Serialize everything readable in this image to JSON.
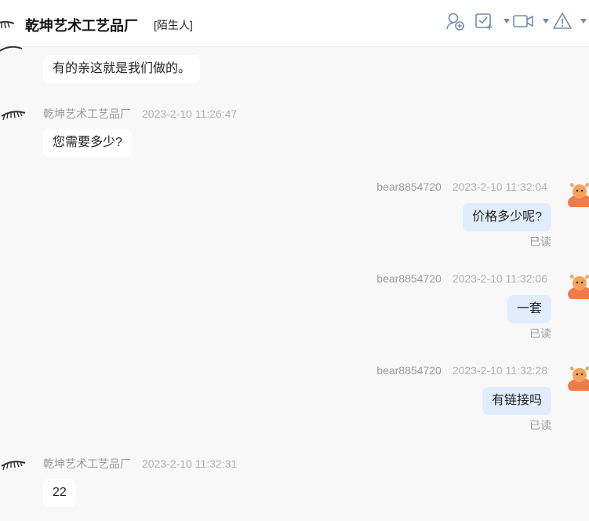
{
  "header": {
    "title": "乾坤艺术工艺品厂",
    "tag": "[陌生人]",
    "icons": [
      "add-contact-icon",
      "calendar-check-icon",
      "video-call-icon",
      "warning-icon"
    ],
    "accent_color": "#6f8bb5"
  },
  "messages": [
    {
      "side": "in",
      "text": "有的亲这就是我们做的。"
    },
    {
      "side": "in",
      "sender": "乾坤艺术工艺品厂",
      "time": "2023-2-10 11:26:47",
      "text": "您需要多少?"
    },
    {
      "side": "out",
      "sender": "bear8854720",
      "time": "2023-2-10 11:32:04",
      "text": "价格多少呢?",
      "status": "已读"
    },
    {
      "side": "out",
      "sender": "bear8854720",
      "time": "2023-2-10 11:32:06",
      "text": "一套",
      "status": "已读"
    },
    {
      "side": "out",
      "sender": "bear8854720",
      "time": "2023-2-10 11:32:28",
      "text": "有链接吗",
      "status": "已读"
    },
    {
      "side": "in",
      "sender": "乾坤艺术工艺品厂",
      "time": "2023-2-10 11:32:31",
      "text": "22"
    }
  ],
  "colors": {
    "background": "#f8f8f8",
    "incoming_bubble": "#ffffff",
    "outgoing_bubble": "#e1edfd"
  }
}
